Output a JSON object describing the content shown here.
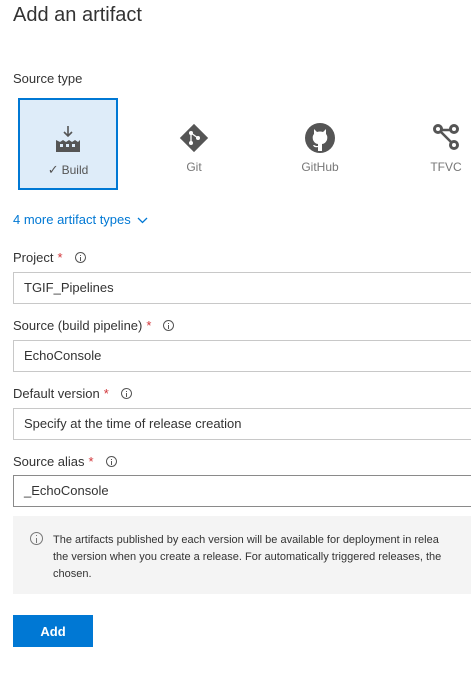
{
  "panel": {
    "title": "Add an artifact"
  },
  "source_type": {
    "label": "Source type",
    "options": [
      {
        "label": "Build",
        "icon": "build-icon",
        "selected": true
      },
      {
        "label": "Git",
        "icon": "git-icon",
        "selected": false
      },
      {
        "label": "GitHub",
        "icon": "github-icon",
        "selected": false
      },
      {
        "label": "TFVC",
        "icon": "tfvc-icon",
        "selected": false
      }
    ],
    "more_link": "4 more artifact types"
  },
  "fields": {
    "project": {
      "label": "Project",
      "value": "TGIF_Pipelines"
    },
    "source": {
      "label": "Source (build pipeline)",
      "value": "EchoConsole"
    },
    "default_version": {
      "label": "Default version",
      "value": "Specify at the time of release creation"
    },
    "source_alias": {
      "label": "Source alias",
      "value": "_EchoConsole"
    }
  },
  "required_marker": "*",
  "info_note": {
    "line1": "The artifacts published by each version will be available for deployment in relea",
    "line2": "the version when you create a release. For automatically triggered releases, the",
    "line3": "chosen."
  },
  "actions": {
    "add_label": "Add"
  },
  "colors": {
    "accent": "#0078d4",
    "selected_bg": "#deecf9",
    "required": "#d13438"
  }
}
